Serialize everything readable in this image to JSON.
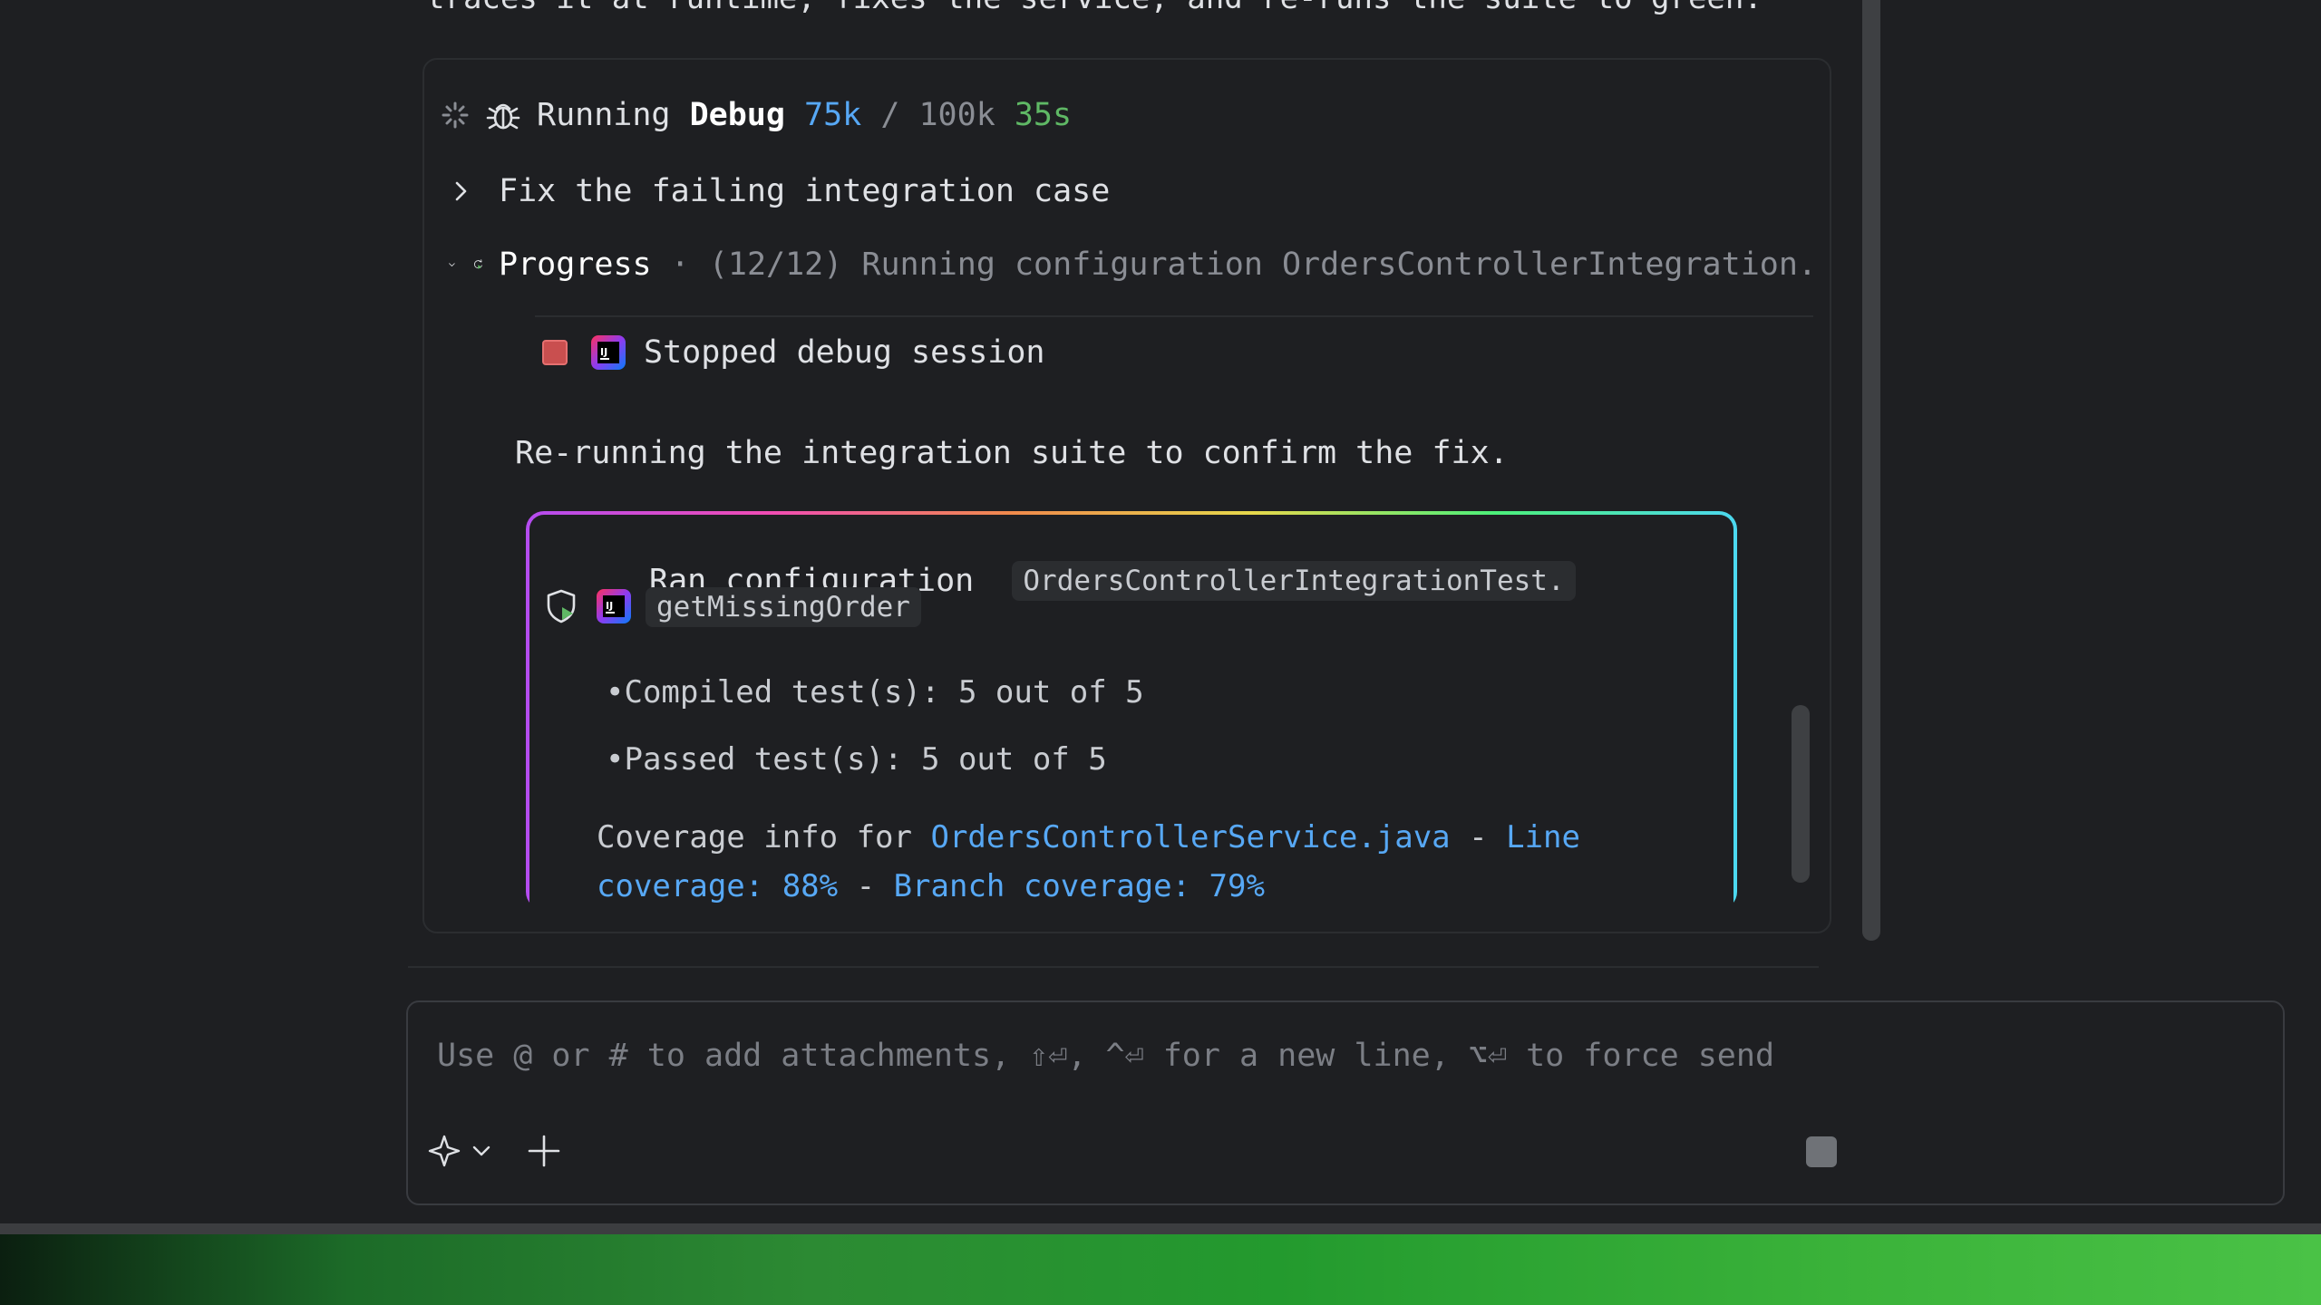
{
  "top_text": "traces it at runtime, fixes the service, and re-runs the suite to green.",
  "agent": {
    "status": "Running",
    "name": "Debug",
    "tokens_used": "75k",
    "separator": "/",
    "tokens_max": "100k",
    "elapsed": "35s"
  },
  "task": {
    "label": "Fix the failing integration case"
  },
  "progress": {
    "label": "Progress",
    "dot": "·",
    "detail": "(12/12) Running configuration OrdersControllerIntegration."
  },
  "stopped": {
    "label": "Stopped debug session"
  },
  "note": "Re-running the integration suite to confirm the fix.",
  "run": {
    "title": "Ran configuration",
    "config_part1": "OrdersControllerIntegrationTest.",
    "config_part2": "getMissingOrder",
    "bullets": [
      "Compiled test(s): 5 out of 5",
      "Passed test(s): 5 out of 5"
    ],
    "coverage": {
      "prefix": "Coverage info for",
      "file": "OrdersControllerService.java",
      "dash1": "-",
      "line_label_1": "Line",
      "line_label_2": "coverage: 88%",
      "dash2": "-",
      "branch_label": "Branch coverage: 79%"
    }
  },
  "composer": {
    "placeholder": "Use @ or # to add attachments, ⇧⏎, ^⏎ for a new line, ⌥⏎ to force send"
  },
  "icons": [
    "spinner-icon",
    "bug-icon",
    "chevron-right-icon",
    "chevron-down-icon",
    "rerun-icon",
    "stop-icon",
    "intellij-icon",
    "sparkle-icon",
    "plus-icon",
    "send-stop-icon"
  ],
  "colors": {
    "accent_blue": "#57a8f5",
    "accent_green": "#5fb865",
    "stop_red": "#c94f4f"
  }
}
